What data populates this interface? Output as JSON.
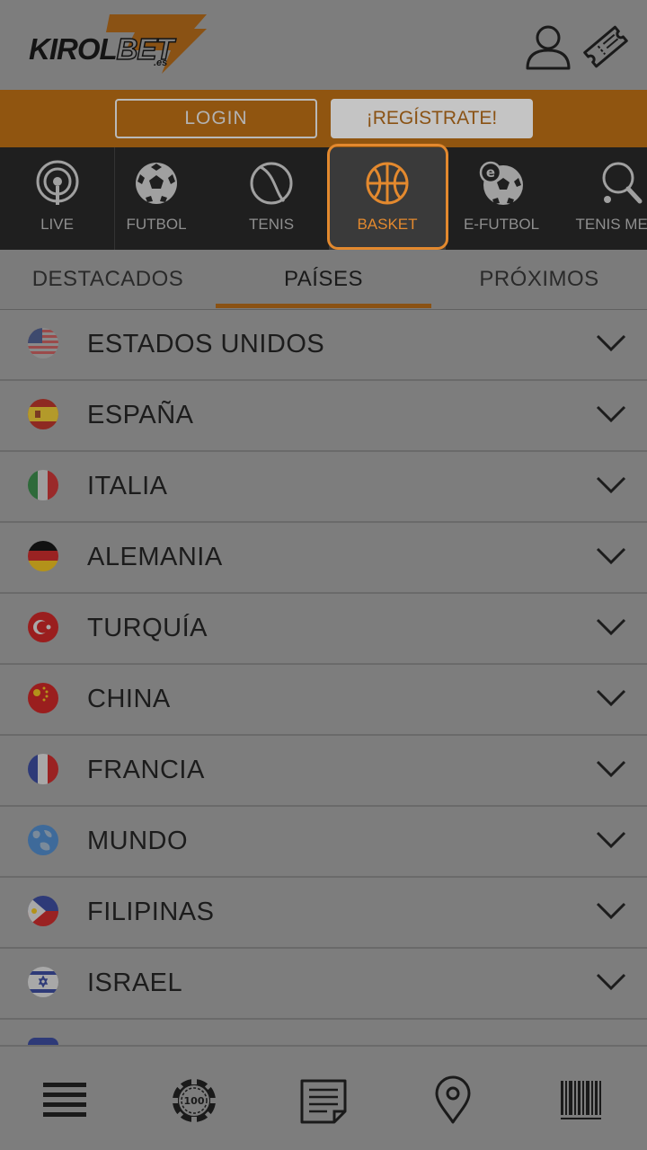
{
  "header": {
    "logo_text_a": "KIROL",
    "logo_text_b": "BET",
    "logo_suffix": ".es",
    "icons": [
      "user-icon",
      "ticket-icon"
    ]
  },
  "auth": {
    "login_label": "LOGIN",
    "register_label": "¡REGÍSTRATE!"
  },
  "sports": [
    {
      "label": "LIVE",
      "icon": "live-broadcast-icon"
    },
    {
      "label": "FUTBOL",
      "icon": "soccer-ball-icon"
    },
    {
      "label": "TENIS",
      "icon": "tennis-ball-icon"
    },
    {
      "label": "BASKET",
      "icon": "basketball-icon",
      "active": true
    },
    {
      "label": "E-FUTBOL",
      "icon": "e-soccer-icon"
    },
    {
      "label": "TENIS MESA",
      "icon": "table-tennis-icon"
    }
  ],
  "tabs": [
    {
      "label": "DESTACADOS"
    },
    {
      "label": "PAÍSES",
      "active": true
    },
    {
      "label": "PRÓXIMOS"
    }
  ],
  "countries": [
    {
      "name": "ESTADOS UNIDOS",
      "flag": "usa-flag-icon"
    },
    {
      "name": "ESPAÑA",
      "flag": "spain-flag-icon"
    },
    {
      "name": "ITALIA",
      "flag": "italy-flag-icon"
    },
    {
      "name": "ALEMANIA",
      "flag": "germany-flag-icon"
    },
    {
      "name": "TURQUÍA",
      "flag": "turkey-flag-icon"
    },
    {
      "name": "CHINA",
      "flag": "china-flag-icon"
    },
    {
      "name": "FRANCIA",
      "flag": "france-flag-icon"
    },
    {
      "name": "MUNDO",
      "flag": "world-globe-icon"
    },
    {
      "name": "FILIPINAS",
      "flag": "philippines-flag-icon"
    },
    {
      "name": "ISRAEL",
      "flag": "israel-flag-icon"
    }
  ],
  "bottom_nav": {
    "casino_chip_text": "100",
    "icons": [
      "menu-icon",
      "casino-chip-icon",
      "bet-slip-icon",
      "location-pin-icon",
      "barcode-icon"
    ]
  },
  "colors": {
    "accent": "#e3892e",
    "brand_bar": "#905510",
    "overlay_bg": "#7d7d7d",
    "sports_bar": "#1f1f1f"
  }
}
